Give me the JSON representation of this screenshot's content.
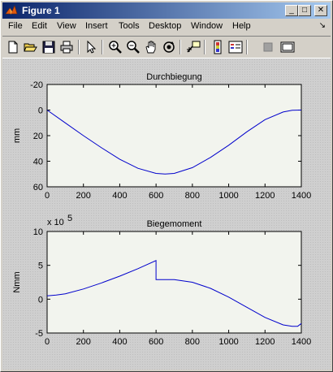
{
  "window": {
    "title": "Figure 1",
    "minimize_glyph": "_",
    "maximize_glyph": "□",
    "close_glyph": "✕"
  },
  "menu": {
    "items": [
      "File",
      "Edit",
      "View",
      "Insert",
      "Tools",
      "Desktop",
      "Window",
      "Help"
    ],
    "arrow": "↘"
  },
  "toolbar": {
    "buttons": [
      "new-figure",
      "open-file",
      "save",
      "print",
      "edit-plot-arrow",
      "zoom-in",
      "zoom-out",
      "pan-hand",
      "rotate-3d",
      "data-cursor",
      "insert-colorbar",
      "insert-legend",
      "hide-plot-tools",
      "show-plot-tools"
    ]
  },
  "colors": {
    "line": "#0000cc",
    "plot_bg": "#f2f4ee",
    "titlebar_start": "#0a246a",
    "titlebar_end": "#a6caf0"
  },
  "chart_data": [
    {
      "type": "line",
      "title": "Durchbiegung",
      "xlabel": "",
      "ylabel": "mm",
      "xlim": [
        0,
        1400
      ],
      "ylim": [
        -20,
        60
      ],
      "y_reversed": true,
      "xticks": [
        0,
        200,
        400,
        600,
        800,
        1000,
        1200,
        1400
      ],
      "yticks": [
        -20,
        0,
        20,
        40,
        60
      ],
      "grid": false,
      "series": [
        {
          "x": [
            0,
            100,
            200,
            300,
            400,
            500,
            600,
            650,
            700,
            800,
            900,
            1000,
            1100,
            1200,
            1300,
            1350,
            1400
          ],
          "values": [
            0,
            10,
            20,
            29.5,
            38.5,
            45.5,
            49.5,
            50,
            49.5,
            45,
            37,
            27.5,
            17,
            7.5,
            1.5,
            0.2,
            0
          ]
        }
      ]
    },
    {
      "type": "line",
      "title": "Biegemoment",
      "xlabel": "",
      "ylabel": "Nmm",
      "y_multiplier": "x 10",
      "y_multiplier_exp": "5",
      "xlim": [
        0,
        1400
      ],
      "ylim": [
        -5,
        10
      ],
      "xticks": [
        0,
        200,
        400,
        600,
        800,
        1000,
        1200,
        1400
      ],
      "yticks": [
        -5,
        0,
        5,
        10
      ],
      "grid": false,
      "series": [
        {
          "x": [
            0,
            50,
            100,
            200,
            300,
            400,
            500,
            600,
            600,
            650,
            700,
            800,
            900,
            1000,
            1100,
            1200,
            1300,
            1350,
            1380,
            1400
          ],
          "values": [
            0.5,
            0.6,
            0.8,
            1.5,
            2.4,
            3.4,
            4.5,
            5.7,
            2.9,
            2.9,
            2.9,
            2.5,
            1.6,
            0.3,
            -1.2,
            -2.7,
            -3.8,
            -4.0,
            -4.0,
            -3.6
          ]
        }
      ]
    }
  ]
}
